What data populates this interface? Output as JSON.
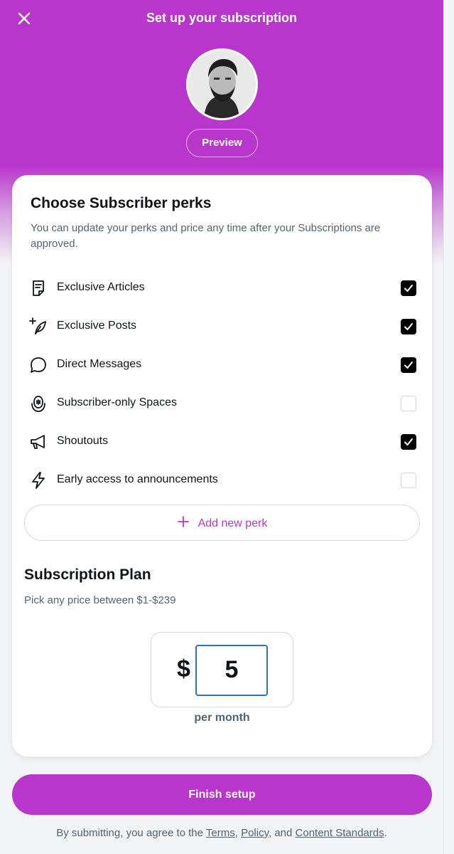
{
  "header": {
    "title": "Set up your subscription",
    "close_icon": "close-icon"
  },
  "profile": {
    "avatar": "avatar",
    "preview_label": "Preview"
  },
  "perks_section": {
    "title": "Choose Subscriber perks",
    "subtitle": "You can update your perks and price any time after your Subscriptions are approved.",
    "items": [
      {
        "label": "Exclusive Articles",
        "icon": "article-icon",
        "checked": true
      },
      {
        "label": "Exclusive Posts",
        "icon": "feather-plus-icon",
        "checked": true
      },
      {
        "label": "Direct Messages",
        "icon": "chat-bubble-icon",
        "checked": true
      },
      {
        "label": "Subscriber-only Spaces",
        "icon": "spaces-icon",
        "checked": false
      },
      {
        "label": "Shoutouts",
        "icon": "megaphone-icon",
        "checked": true
      },
      {
        "label": "Early access to announcements",
        "icon": "lightning-icon",
        "checked": false
      }
    ],
    "add_perk_label": "Add new perk"
  },
  "plan": {
    "title": "Subscription Plan",
    "subtitle": "Pick any price between $1-$239",
    "currency": "$",
    "price_value": "5",
    "period_label": "per month"
  },
  "actions": {
    "finish_label": "Finish setup"
  },
  "legal": {
    "prefix": "By submitting, you agree to the ",
    "terms": "Terms",
    "sep1": ", ",
    "policy": "Policy",
    "sep2": ", and ",
    "content_standards": "Content Standards",
    "suffix": "."
  },
  "colors": {
    "accent": "#b936cc",
    "input_border": "#2f6fc6"
  }
}
